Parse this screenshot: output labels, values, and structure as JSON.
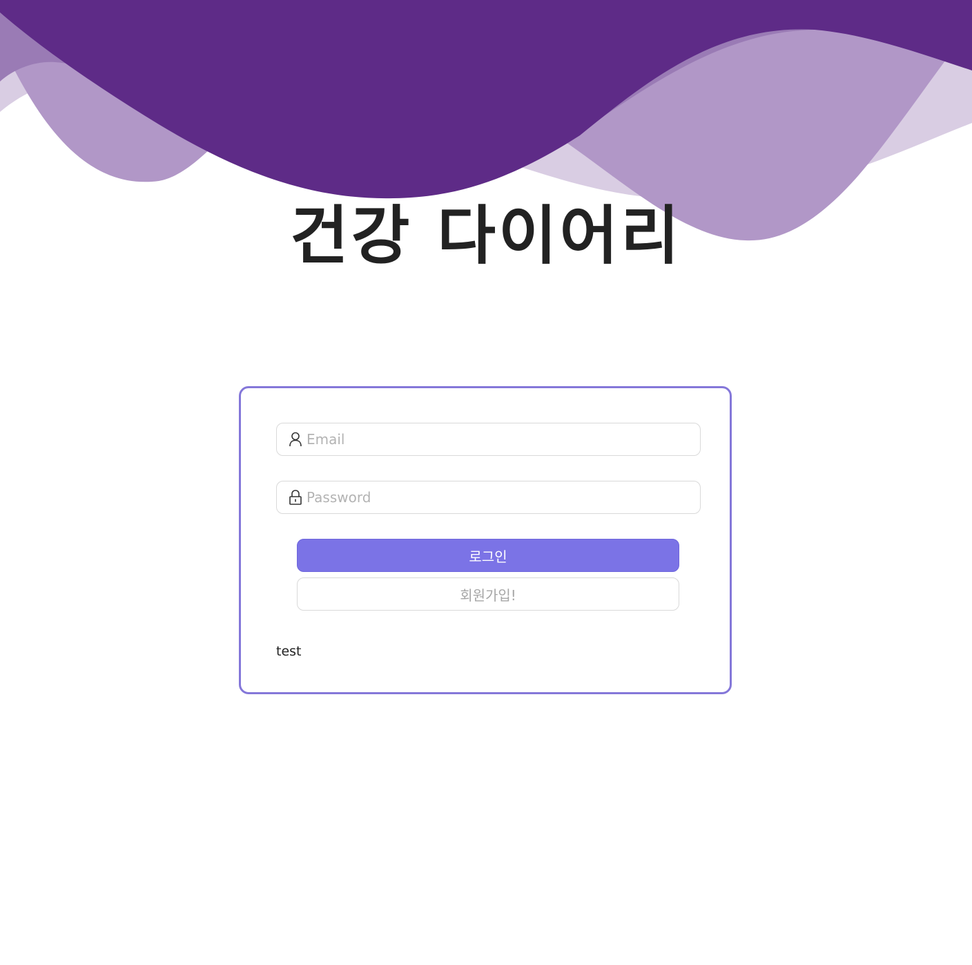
{
  "header": {
    "title": "건강 다이어리"
  },
  "login_form": {
    "email": {
      "placeholder": "Email",
      "value": ""
    },
    "password": {
      "placeholder": "Password",
      "value": ""
    },
    "login_button_label": "로그인",
    "signup_button_label": "회원가입!",
    "status_text": "test"
  },
  "colors": {
    "wave_dark": "#5e2b87",
    "wave_mid": "#9a7bb5",
    "wave_light": "#d9cde3",
    "card_border": "#8477d9",
    "login_button": "#7b73e6"
  },
  "icons": {
    "email_field": "user-icon",
    "password_field": "lock-icon"
  }
}
